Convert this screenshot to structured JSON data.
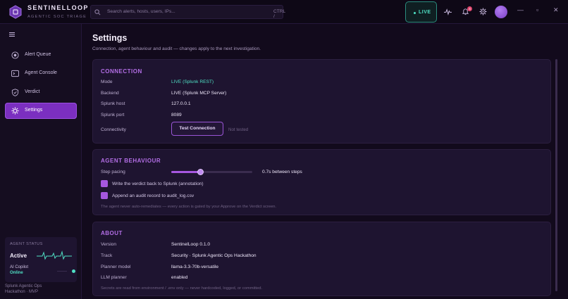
{
  "brand": {
    "name": "SENTINELLOOP",
    "tagline": "AGENTIC SOC TRIAGE"
  },
  "search": {
    "placeholder": "Search alerts, hosts, users, IPs...",
    "shortcut": "CTRL /"
  },
  "status": {
    "live_label": "LIVE",
    "notification_count": "4"
  },
  "window": {
    "minimize": "—",
    "maximize": "▫",
    "close": "✕"
  },
  "sidebar": {
    "items": [
      {
        "label": "Alert Queue",
        "icon": "target-icon"
      },
      {
        "label": "Agent Console",
        "icon": "terminal-icon"
      },
      {
        "label": "Verdict",
        "icon": "shield-icon"
      },
      {
        "label": "Settings",
        "icon": "gear-icon",
        "active": true
      }
    ],
    "agent_status": {
      "title": "AGENT STATUS",
      "state": "Active",
      "copilot_label": "AI Copilot",
      "copilot_state": "Online"
    },
    "footer": [
      "Splunk Agentic Ops",
      "Hackathon · MVP"
    ]
  },
  "page": {
    "title": "Settings",
    "subtitle": "Connection, agent behaviour and audit — changes apply to the next investigation."
  },
  "connection": {
    "title": "CONNECTION",
    "rows": [
      {
        "label": "Mode",
        "value": "LIVE (Splunk REST)"
      },
      {
        "label": "Backend",
        "value": "LIVE (Splunk MCP Server)"
      },
      {
        "label": "Splunk host",
        "value": "127.0.0.1"
      },
      {
        "label": "Splunk port",
        "value": "8089"
      }
    ],
    "connectivity_label": "Connectivity",
    "test_button": "Test Connection",
    "test_status": "Not tested"
  },
  "agent_behaviour": {
    "title": "AGENT BEHAVIOUR",
    "step_pacing_label": "Step pacing",
    "step_pacing_fraction": 0.36,
    "step_pacing_value": "0.7s between steps",
    "options": [
      {
        "label": "Write the verdict back to Splunk (annotation)",
        "checked": true
      },
      {
        "label": "Append an audit record to audit_log.csv",
        "checked": true
      }
    ],
    "note": "The agent never auto-remediates — every action is gated by your Approve on the Verdict screen."
  },
  "about": {
    "title": "ABOUT",
    "rows": [
      {
        "label": "Version",
        "value": "SentinelLoop 0.1.0"
      },
      {
        "label": "Track",
        "value": "Security · Splunk Agentic Ops Hackathon"
      },
      {
        "label": "Planner model",
        "value": "llama-3.3-70b-versatile"
      },
      {
        "label": "LLM planner",
        "value": "enabled"
      }
    ],
    "note": "Secrets are read from environment / .env only — never hardcoded, logged, or committed."
  },
  "colors": {
    "accent": "#a657e0",
    "live": "#4fe0c4",
    "active_nav": "#7b2fc0"
  }
}
